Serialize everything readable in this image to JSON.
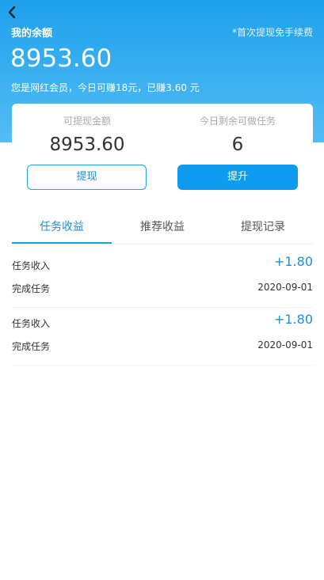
{
  "header": {
    "balance_label": "我的余额",
    "free_note": "*首次提现免手续费",
    "balance_amount": "8953.60",
    "member_line": "您是网红会员，今日可赚18元，已赚3.60 元"
  },
  "card": {
    "withdrawable_label": "可提现金额",
    "withdrawable_value": "8953.60",
    "tasks_left_label": "今日剩余可做任务",
    "tasks_left_value": "6",
    "withdraw_button": "提现",
    "upgrade_button": "提升"
  },
  "tabs": [
    {
      "label": "任务收益",
      "active": true
    },
    {
      "label": "推荐收益",
      "active": false
    },
    {
      "label": "提现记录",
      "active": false
    }
  ],
  "records": [
    {
      "title": "任务收入",
      "amount": "+1.80",
      "subtitle": "完成任务",
      "date": "2020-09-01"
    },
    {
      "title": "任务收入",
      "amount": "+1.80",
      "subtitle": "完成任务",
      "date": "2020-09-01"
    }
  ],
  "colors": {
    "accent": "#1e9ee8",
    "header_top": "#1ea0ec",
    "header_bottom": "#53bdf6"
  },
  "icons": {
    "back": "chevron-left-icon"
  }
}
